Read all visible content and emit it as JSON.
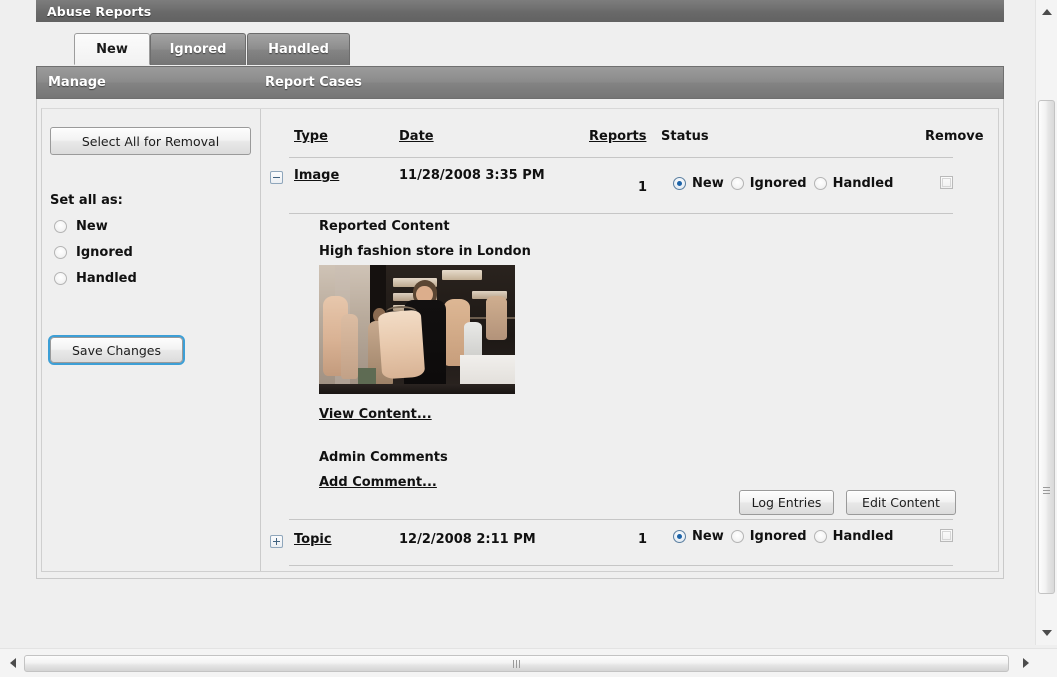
{
  "window": {
    "title": "Abuse Reports"
  },
  "tabs": [
    {
      "label": "New",
      "active": true
    },
    {
      "label": "Ignored",
      "active": false
    },
    {
      "label": "Handled",
      "active": false
    }
  ],
  "sub_header": {
    "manage_label": "Manage",
    "cases_label": "Report Cases"
  },
  "sidebar": {
    "select_all_button": "Select All for Removal",
    "set_all_label": "Set all as:",
    "radios": [
      {
        "label": "New",
        "checked": false
      },
      {
        "label": "Ignored",
        "checked": false
      },
      {
        "label": "Handled",
        "checked": false
      }
    ],
    "save_button": "Save Changes"
  },
  "table": {
    "columns": {
      "type": "Type",
      "date": "Date",
      "reports": "Reports",
      "status": "Status",
      "remove": "Remove"
    },
    "rows": [
      {
        "expanded": true,
        "expander_icon": "minus-box-icon",
        "type": "Image",
        "date": "11/28/2008 3:35 PM",
        "reports": "1",
        "status_options": [
          {
            "label": "New",
            "selected": true
          },
          {
            "label": "Ignored",
            "selected": false
          },
          {
            "label": "Handled",
            "selected": false
          }
        ],
        "remove_checked": false,
        "detail": {
          "reported_content_label": "Reported Content",
          "content_title": "High fashion store in London",
          "thumbnail_alt": "clothing-store-photo",
          "view_content_link": "View Content...",
          "admin_comments_label": "Admin Comments",
          "add_comment_link": "Add Comment...",
          "log_entries_button": "Log Entries",
          "edit_content_button": "Edit Content"
        }
      },
      {
        "expanded": false,
        "expander_icon": "plus-box-icon",
        "type": "Topic",
        "date": "12/2/2008 2:11 PM",
        "reports": "1",
        "status_options": [
          {
            "label": "New",
            "selected": true
          },
          {
            "label": "Ignored",
            "selected": false
          },
          {
            "label": "Handled",
            "selected": false
          }
        ],
        "remove_checked": false
      }
    ]
  },
  "colors": {
    "header_gray": "#6e6e6e",
    "subheader_gray": "#8b8b8b",
    "page_background": "#efefef",
    "radio_accent": "#1c63a8",
    "focus_blue": "#3d9fd6",
    "text": "#111111"
  },
  "scrollbars": {
    "vertical": {
      "up_arrow": "scroll-up-arrow",
      "down_arrow": "scroll-down-arrow"
    },
    "horizontal": {
      "left_arrow": "scroll-left-arrow",
      "right_arrow": "scroll-right-arrow"
    }
  }
}
